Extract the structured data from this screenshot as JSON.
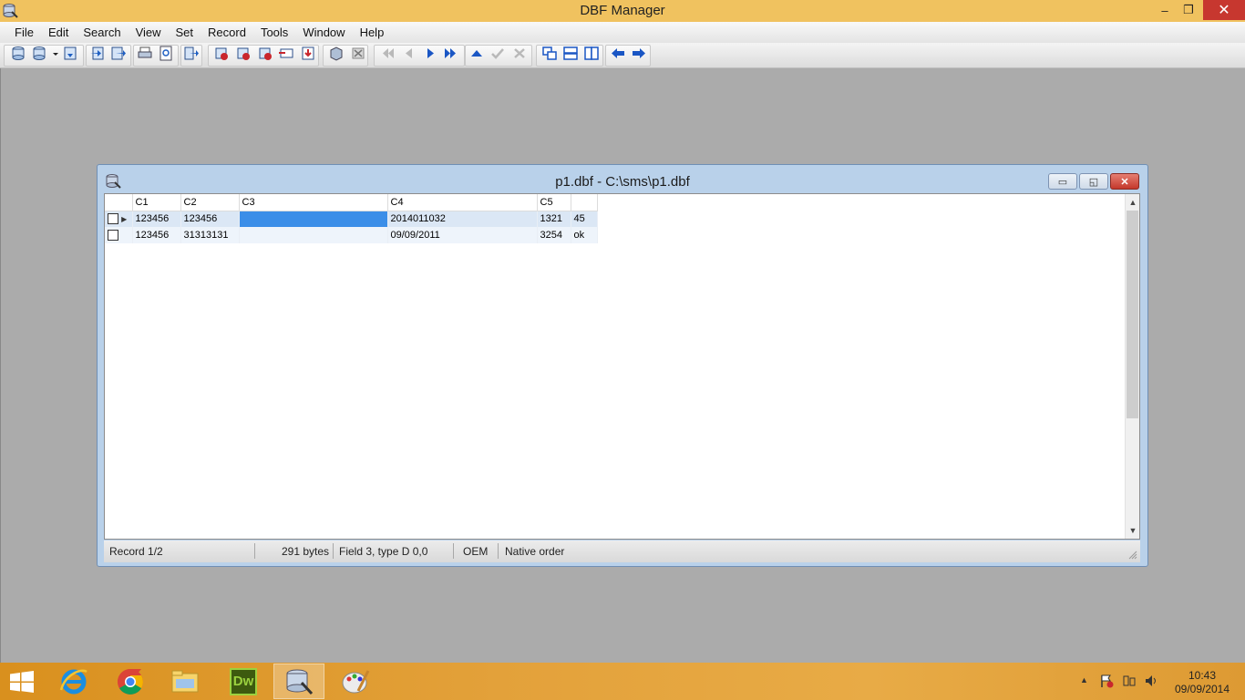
{
  "app": {
    "title": "DBF Manager",
    "window_controls": {
      "minimize": "‒",
      "maximize": "❐",
      "close": "✕"
    }
  },
  "menu": [
    "File",
    "Edit",
    "Search",
    "View",
    "Set",
    "Record",
    "Tools",
    "Window",
    "Help"
  ],
  "toolbar_icons": [
    "new-database-icon",
    "open-database-icon",
    "dropdown-arrow-icon",
    "save-icon",
    "import-icon",
    "export-icon",
    "print-icon",
    "print-preview-icon",
    "exit-icon",
    "add-record-icon",
    "edit-record-icon",
    "delete-record-icon",
    "insert-record-icon",
    "append-record-icon",
    "pack-icon",
    "zap-icon",
    "first-record-icon",
    "prior-record-icon",
    "next-record-icon",
    "last-record-icon",
    "post-up-icon",
    "confirm-icon",
    "cancel-icon",
    "cascade-icon",
    "tile-horizontal-icon",
    "tile-vertical-icon",
    "back-icon",
    "forward-icon"
  ],
  "child_window": {
    "title": "p1.dbf - C:\\sms\\p1.dbf",
    "controls": {
      "minimize": "▭",
      "maximize": "◱",
      "close": "✕"
    }
  },
  "grid": {
    "columns": [
      "C1",
      "C2",
      "C3",
      "C4",
      "C5",
      ""
    ],
    "rows": [
      {
        "C1": "123456",
        "C2": "123456",
        "C3": "",
        "C4": "2014011032",
        "C5": "1321",
        "C6": "45"
      },
      {
        "C1": "123456",
        "C2": "31313131",
        "C3": "",
        "C4": "09/09/2011",
        "C5": "3254",
        "C6": "ok"
      }
    ],
    "selected_row": 0,
    "selected_column": "C3"
  },
  "statusbar": {
    "record": "Record 1/2",
    "size": "291 bytes",
    "field": "Field 3, type D 0,0",
    "codepage": "OEM",
    "order": "Native order"
  },
  "taskbar": {
    "apps": [
      "internet-explorer-icon",
      "chrome-icon",
      "file-explorer-icon",
      "dreamweaver-icon",
      "dbf-manager-icon",
      "paint-icon"
    ],
    "dreamweaver_label": "Dw",
    "clock_time": "10:43",
    "clock_date": "09/09/2014",
    "colors": {
      "taskbar": "#e3a13a",
      "titlebar": "#f0c25f",
      "selection": "#3b8ee8"
    }
  }
}
